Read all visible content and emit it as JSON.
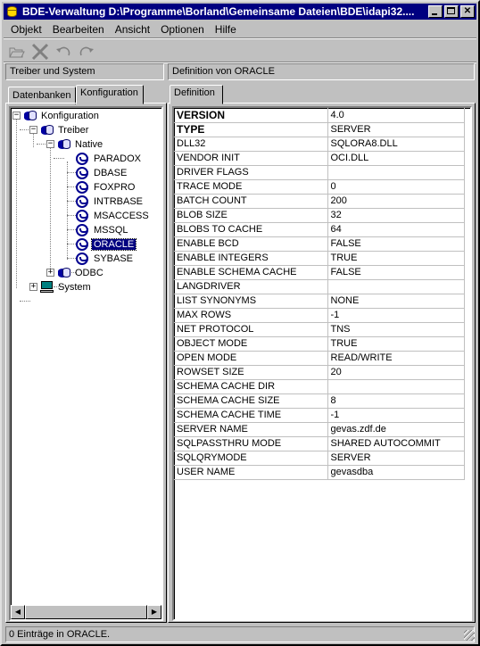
{
  "window": {
    "title": "BDE-Verwaltung  D:\\Programme\\Borland\\Gemeinsame Dateien\\BDE\\idapi32...."
  },
  "menu": [
    {
      "label": "Objekt"
    },
    {
      "label": "Bearbeiten"
    },
    {
      "label": "Ansicht"
    },
    {
      "label": "Optionen"
    },
    {
      "label": "Hilfe"
    }
  ],
  "toolbar": {
    "icons": [
      "open-icon",
      "delete-icon",
      "undo-icon",
      "redo-icon"
    ]
  },
  "left_panel": {
    "header": "Treiber und System",
    "tabs": [
      {
        "label": "Datenbanken"
      },
      {
        "label": "Konfiguration"
      }
    ],
    "active_tab": "Konfiguration",
    "tree": {
      "root": "Konfiguration",
      "treiber": "Treiber",
      "native": "Native",
      "drivers": [
        "PARADOX",
        "DBASE",
        "FOXPRO",
        "INTRBASE",
        "MSACCESS",
        "MSSQL",
        "ORACLE",
        "SYBASE"
      ],
      "selected": "ORACLE",
      "odbc": "ODBC",
      "system": "System"
    }
  },
  "right_panel": {
    "header": "Definition von ORACLE",
    "tab": "Definition",
    "rows": [
      {
        "key": "VERSION",
        "value": "4.0"
      },
      {
        "key": "TYPE",
        "value": "SERVER"
      },
      {
        "key": "DLL32",
        "value": "SQLORA8.DLL"
      },
      {
        "key": "VENDOR INIT",
        "value": "OCI.DLL"
      },
      {
        "key": "DRIVER FLAGS",
        "value": ""
      },
      {
        "key": "TRACE MODE",
        "value": "0"
      },
      {
        "key": "BATCH COUNT",
        "value": "200"
      },
      {
        "key": "BLOB SIZE",
        "value": "32"
      },
      {
        "key": "BLOBS TO CACHE",
        "value": "64"
      },
      {
        "key": "ENABLE BCD",
        "value": "FALSE"
      },
      {
        "key": "ENABLE INTEGERS",
        "value": "TRUE"
      },
      {
        "key": "ENABLE SCHEMA CACHE",
        "value": "FALSE"
      },
      {
        "key": "LANGDRIVER",
        "value": ""
      },
      {
        "key": "LIST SYNONYMS",
        "value": "NONE"
      },
      {
        "key": "MAX ROWS",
        "value": "-1"
      },
      {
        "key": "NET PROTOCOL",
        "value": "TNS"
      },
      {
        "key": "OBJECT MODE",
        "value": "TRUE"
      },
      {
        "key": "OPEN MODE",
        "value": "READ/WRITE"
      },
      {
        "key": "ROWSET SIZE",
        "value": "20"
      },
      {
        "key": "SCHEMA CACHE DIR",
        "value": ""
      },
      {
        "key": "SCHEMA CACHE SIZE",
        "value": "8"
      },
      {
        "key": "SCHEMA CACHE TIME",
        "value": "-1"
      },
      {
        "key": "SERVER NAME",
        "value": "gevas.zdf.de"
      },
      {
        "key": "SQLPASSTHRU MODE",
        "value": "SHARED AUTOCOMMIT"
      },
      {
        "key": "SQLQRYMODE",
        "value": "SERVER"
      },
      {
        "key": "USER NAME",
        "value": "gevasdba"
      }
    ]
  },
  "status": {
    "text": "0 Einträge in ORACLE."
  }
}
